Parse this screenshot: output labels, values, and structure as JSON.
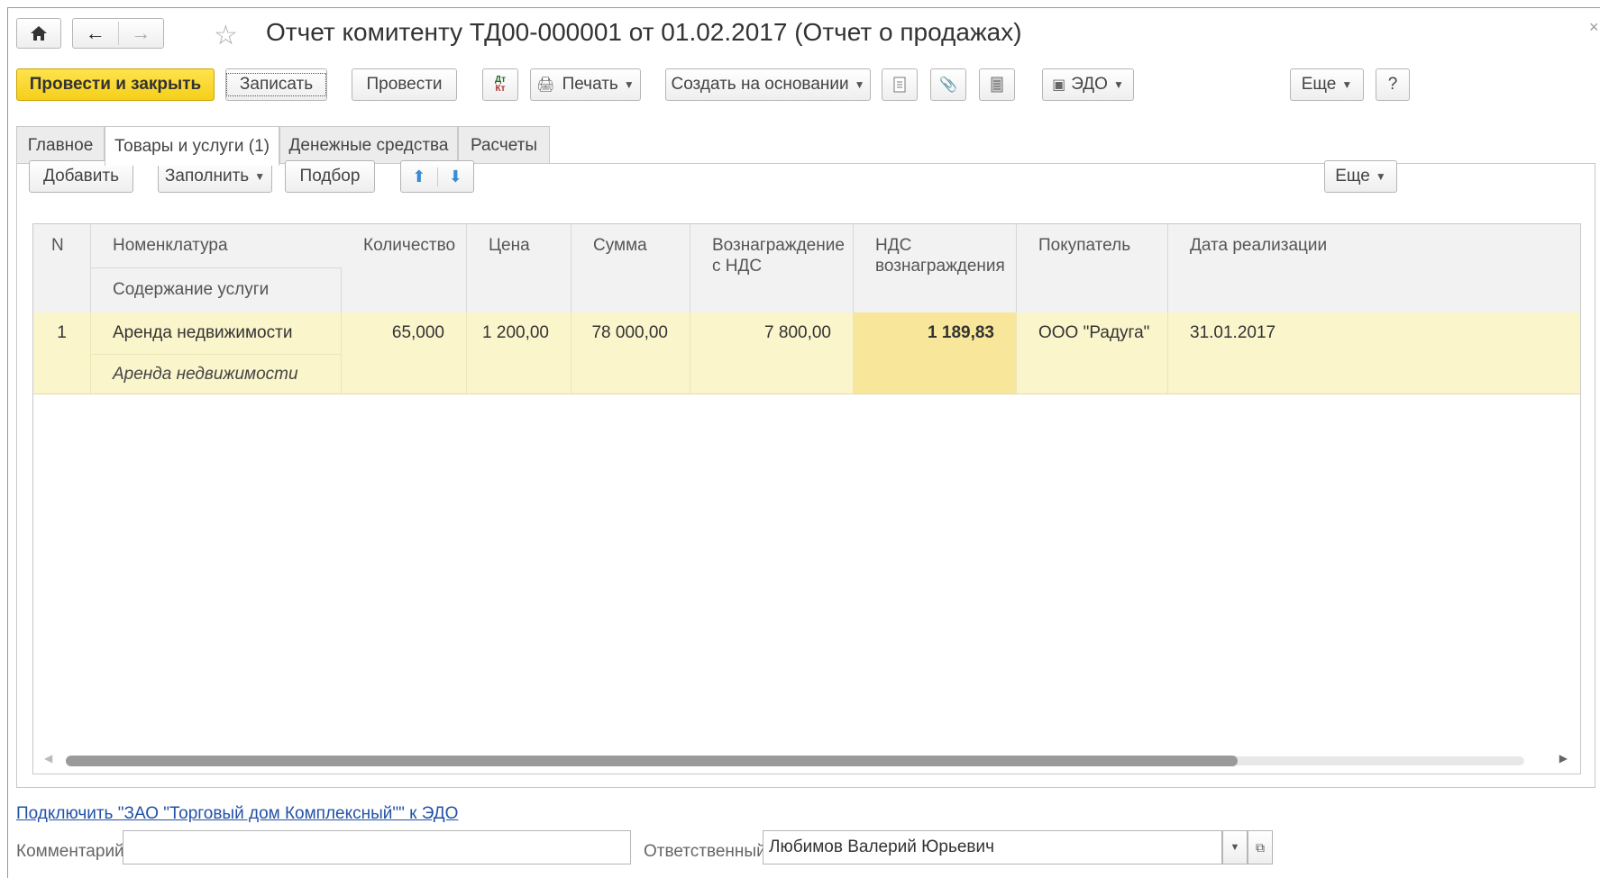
{
  "window": {
    "title": "Отчет комитенту ТД00-000001 от 01.02.2017 (Отчет о продажах)",
    "close_glyph": "×"
  },
  "toolbar": {
    "post_close": "Провести и закрыть",
    "save": "Записать",
    "post": "Провести",
    "print": "Печать",
    "create_based": "Создать на основании",
    "edo": "ЭДО",
    "more": "Еще",
    "help": "?",
    "dtkt_top": "Дт",
    "dtkt_bottom": "Кт"
  },
  "tabs": [
    {
      "label": "Главное"
    },
    {
      "label": "Товары и услуги (1)"
    },
    {
      "label": "Денежные средства"
    },
    {
      "label": "Расчеты"
    }
  ],
  "table_toolbar": {
    "add": "Добавить",
    "fill": "Заполнить",
    "select": "Подбор",
    "more": "Еще"
  },
  "table": {
    "headers": {
      "n": "N",
      "nomenclature": "Номенклатура",
      "service_content": "Содержание услуги",
      "quantity": "Количество",
      "price": "Цена",
      "sum": "Сумма",
      "reward_line1": "Вознаграждение",
      "reward_line2": "с НДС",
      "vat_line1": "НДС",
      "vat_line2": "вознаграждения",
      "buyer": "Покупатель",
      "date": "Дата реализации"
    },
    "rows": [
      {
        "n": "1",
        "nomenclature": "Аренда недвижимости",
        "service_content": "Аренда недвижимости",
        "quantity": "65,000",
        "price": "1 200,00",
        "sum": "78 000,00",
        "reward": "7 800,00",
        "vat": "1 189,83",
        "buyer": "ООО \"Радуга\"",
        "date": "31.01.2017"
      }
    ]
  },
  "footer": {
    "edo_link": "Подключить \"ЗАО \"Торговый дом Комплексный\"\" к ЭДО",
    "comment_label": "Комментарий:",
    "comment_value": "",
    "responsible_label": "Ответственный:",
    "responsible_value": "Любимов Валерий Юрьевич"
  }
}
